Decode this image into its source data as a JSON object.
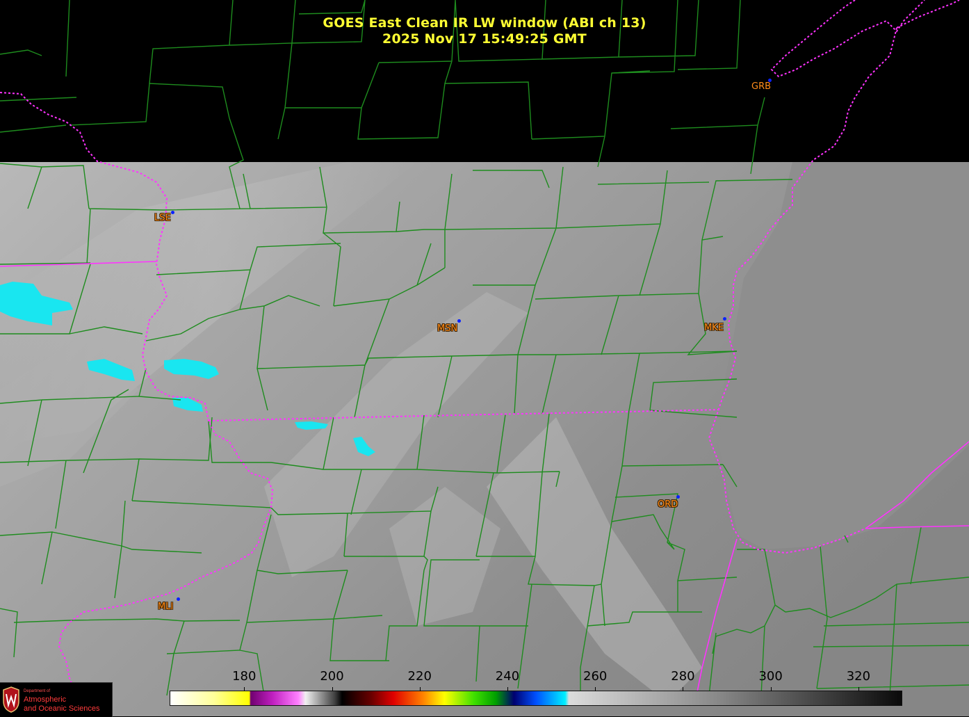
{
  "title": {
    "line1": "GOES East Clean IR LW window (ABI ch 13)",
    "line2": "2025 Nov 17  15:49:25 GMT"
  },
  "stations": [
    {
      "code": "GRB"
    },
    {
      "code": "LSE"
    },
    {
      "code": "MSN"
    },
    {
      "code": "MKE"
    },
    {
      "code": "ORD"
    },
    {
      "code": "MLI"
    }
  ],
  "colorbar": {
    "unit_ticks": [
      "180",
      "200",
      "220",
      "240",
      "260",
      "280",
      "300",
      "320"
    ],
    "range_min": 163,
    "range_max": 330
  },
  "logo": {
    "line1": "Department of",
    "line2": "Atmospheric",
    "line3": "and Oceanic Sciences"
  },
  "colors": {
    "title": "#ffff33",
    "state_border": "#ff33ff",
    "county_border": "#1e8c1e",
    "station_label": "#ff8c1a",
    "station_dot": "#0a22ff",
    "cold_cloud": "#19e6f0"
  }
}
